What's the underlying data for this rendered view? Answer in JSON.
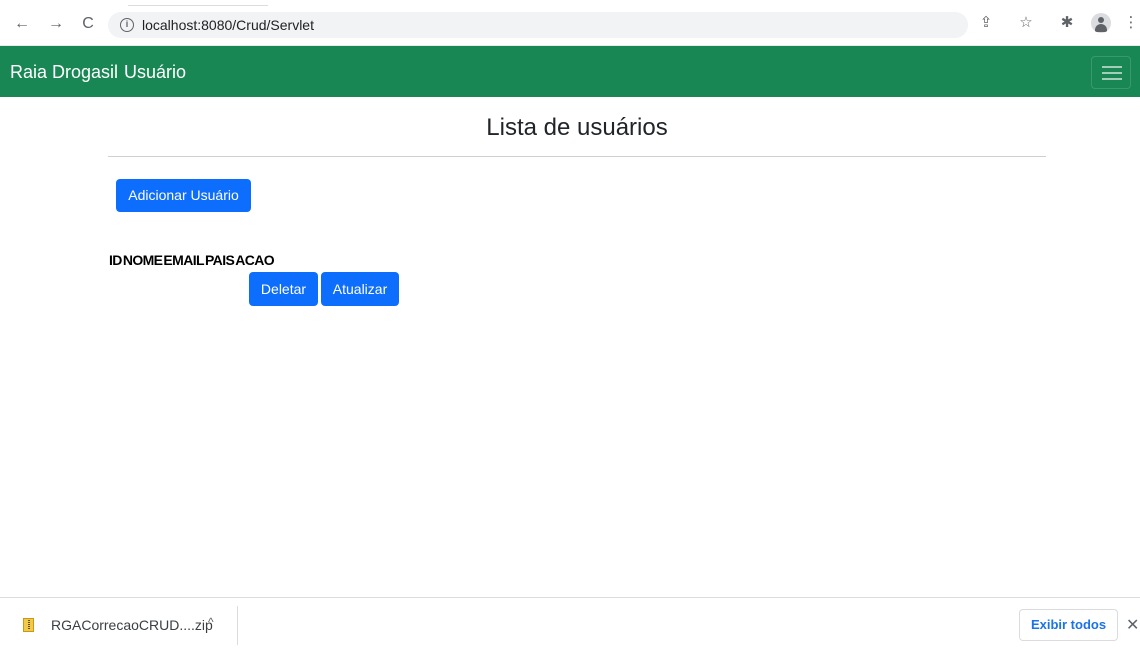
{
  "browser": {
    "back": "←",
    "forward": "→",
    "reload": "C",
    "info": "i",
    "url": "localhost:8080/Crud/Servlet",
    "share": "⇪",
    "star": "☆",
    "extensions": "✱",
    "menu": "⋮"
  },
  "navbar": {
    "brand": "Raia Drogasil",
    "link": "Usuário"
  },
  "page": {
    "title": "Lista de usuários",
    "add_button": "Adicionar Usuário"
  },
  "table": {
    "headers": [
      "ID",
      "NOME",
      "EMAIL",
      "PAIS",
      "ACAO"
    ],
    "actions": {
      "delete": "Deletar",
      "update": "Atualizar"
    }
  },
  "downloads": {
    "file_name": "RGACorrecaoCRUD....zip",
    "chevron": "^",
    "show_all": "Exibir todos",
    "close": "✕"
  },
  "colors": {
    "navbar": "#198754",
    "primary_button": "#0d6efd"
  }
}
